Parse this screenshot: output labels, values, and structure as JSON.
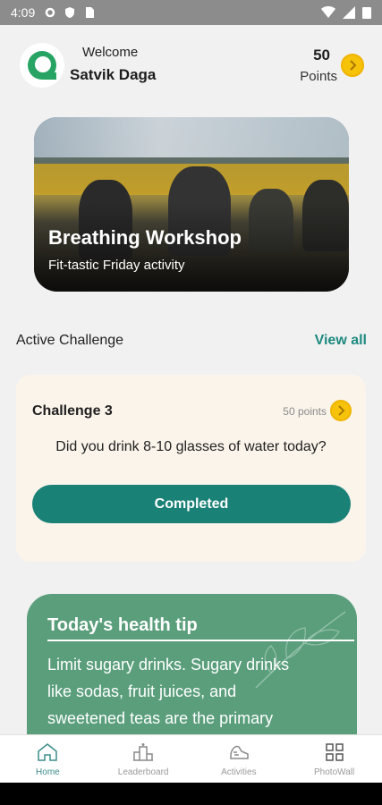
{
  "status_bar": {
    "time": "4:09"
  },
  "header": {
    "welcome": "Welcome",
    "user_name": "Satvik Daga",
    "points_value": "50",
    "points_label": "Points"
  },
  "banner": {
    "title": "Breathing Workshop",
    "subtitle": "Fit-tastic Friday activity"
  },
  "active_challenge_section": {
    "title": "Active Challenge",
    "view_all": "View all"
  },
  "challenge": {
    "title": "Challenge 3",
    "points": "50 points",
    "question": "Did you drink 8-10 glasses of water today?",
    "button_label": "Completed"
  },
  "health_tip": {
    "title": "Today's health tip",
    "text": "Limit sugary drinks. Sugary drinks like sodas, fruit juices, and sweetened teas are the primary"
  },
  "bottom_nav": {
    "items": [
      {
        "label": "Home",
        "icon": "home-icon",
        "active": true
      },
      {
        "label": "Leaderboard",
        "icon": "leaderboard-icon",
        "active": false
      },
      {
        "label": "Activities",
        "icon": "activities-icon",
        "active": false
      },
      {
        "label": "PhotoWall",
        "icon": "photowall-icon",
        "active": false
      }
    ]
  },
  "colors": {
    "accent": "#1a8177",
    "tip_background": "#5a9e7c",
    "card_background": "#fbf4eb",
    "coin": "#f6c20a"
  }
}
